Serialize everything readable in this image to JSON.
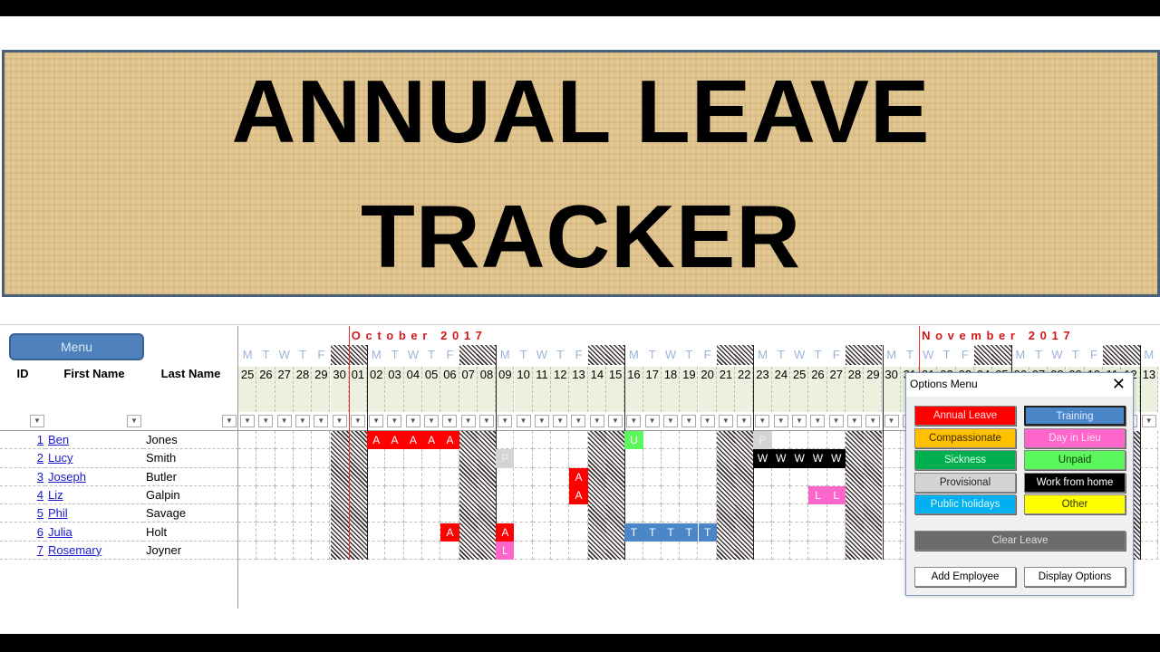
{
  "banner": {
    "line1": "ANNUAL LEAVE",
    "line2": "TRACKER"
  },
  "menu_button": "Menu",
  "columns": {
    "id": "ID",
    "first": "First Name",
    "last": "Last Name"
  },
  "months": [
    {
      "label": "O c t o b e r   2 0 1 7",
      "start": "2017-10-01"
    },
    {
      "label": "N o v e m b e r   2 0 1 7",
      "start": "2017-11-01"
    }
  ],
  "days": [
    {
      "d": "25",
      "w": "M"
    },
    {
      "d": "26",
      "w": "T"
    },
    {
      "d": "27",
      "w": "W"
    },
    {
      "d": "28",
      "w": "T"
    },
    {
      "d": "29",
      "w": "F"
    },
    {
      "d": "30",
      "w": ""
    },
    {
      "d": "01",
      "w": ""
    },
    {
      "d": "02",
      "w": "M"
    },
    {
      "d": "03",
      "w": "T"
    },
    {
      "d": "04",
      "w": "W"
    },
    {
      "d": "05",
      "w": "T"
    },
    {
      "d": "06",
      "w": "F"
    },
    {
      "d": "07",
      "w": ""
    },
    {
      "d": "08",
      "w": ""
    },
    {
      "d": "09",
      "w": "M"
    },
    {
      "d": "10",
      "w": "T"
    },
    {
      "d": "11",
      "w": "W"
    },
    {
      "d": "12",
      "w": "T"
    },
    {
      "d": "13",
      "w": "F"
    },
    {
      "d": "14",
      "w": ""
    },
    {
      "d": "15",
      "w": ""
    },
    {
      "d": "16",
      "w": "M"
    },
    {
      "d": "17",
      "w": "T"
    },
    {
      "d": "18",
      "w": "W"
    },
    {
      "d": "19",
      "w": "T"
    },
    {
      "d": "20",
      "w": "F"
    },
    {
      "d": "21",
      "w": ""
    },
    {
      "d": "22",
      "w": ""
    },
    {
      "d": "23",
      "w": "M"
    },
    {
      "d": "24",
      "w": "T"
    },
    {
      "d": "25",
      "w": "W"
    },
    {
      "d": "26",
      "w": "T"
    },
    {
      "d": "27",
      "w": "F"
    },
    {
      "d": "28",
      "w": ""
    },
    {
      "d": "29",
      "w": ""
    },
    {
      "d": "30",
      "w": "M"
    },
    {
      "d": "31",
      "w": "T"
    },
    {
      "d": "01",
      "w": "W"
    },
    {
      "d": "02",
      "w": "T"
    },
    {
      "d": "03",
      "w": "F"
    },
    {
      "d": "04",
      "w": ""
    },
    {
      "d": "05",
      "w": ""
    },
    {
      "d": "06",
      "w": "M"
    },
    {
      "d": "07",
      "w": "T"
    },
    {
      "d": "08",
      "w": "W"
    },
    {
      "d": "09",
      "w": "T"
    },
    {
      "d": "10",
      "w": "F"
    },
    {
      "d": "11",
      "w": ""
    },
    {
      "d": "12",
      "w": ""
    },
    {
      "d": "13",
      "w": "M"
    }
  ],
  "employees": [
    {
      "id": "1",
      "first": "Ben",
      "last": "Jones",
      "leave": [
        [
          "10-02",
          "A"
        ],
        [
          "10-03",
          "A"
        ],
        [
          "10-04",
          "A"
        ],
        [
          "10-05",
          "A"
        ],
        [
          "10-06",
          "A"
        ],
        [
          "10-16",
          "U"
        ],
        [
          "10-23",
          "P"
        ]
      ]
    },
    {
      "id": "2",
      "first": "Lucy",
      "last": "Smith",
      "leave": [
        [
          "10-09",
          "P"
        ],
        [
          "10-23",
          "W"
        ],
        [
          "10-24",
          "W"
        ],
        [
          "10-25",
          "W"
        ],
        [
          "10-26",
          "W"
        ],
        [
          "10-27",
          "W"
        ]
      ]
    },
    {
      "id": "3",
      "first": "Joseph",
      "last": "Butler",
      "leave": [
        [
          "10-13",
          "A"
        ]
      ]
    },
    {
      "id": "4",
      "first": "Liz",
      "last": "Galpin",
      "leave": [
        [
          "10-13",
          "A"
        ],
        [
          "10-26",
          "L"
        ],
        [
          "10-27",
          "L"
        ]
      ]
    },
    {
      "id": "5",
      "first": "Phil",
      "last": "Savage",
      "leave": []
    },
    {
      "id": "6",
      "first": "Julia",
      "last": "Holt",
      "leave": [
        [
          "10-06",
          "A"
        ],
        [
          "10-09",
          "A"
        ],
        [
          "10-16",
          "T"
        ],
        [
          "10-17",
          "T"
        ],
        [
          "10-18",
          "T"
        ],
        [
          "10-19",
          "T"
        ],
        [
          "10-20",
          "T"
        ]
      ]
    },
    {
      "id": "7",
      "first": "Rosemary",
      "last": "Joyner",
      "leave": [
        [
          "10-09",
          "L"
        ]
      ]
    }
  ],
  "leave_colors": {
    "A": "#ff0000",
    "U": "#5cf75c",
    "P": "#d4d4d4",
    "W": "#000000",
    "L": "#ff66cc",
    "T": "#4a86c8"
  },
  "options_menu": {
    "title": "Options Menu",
    "buttons": [
      {
        "label": "Annual Leave",
        "bg": "#ff0000",
        "fg": "#ffe0e0"
      },
      {
        "label": "Training",
        "bg": "#4a86c8",
        "fg": "#e0ecff"
      },
      {
        "label": "Compassionate",
        "bg": "#ffc000",
        "fg": "#3a2a00"
      },
      {
        "label": "Day in Lieu",
        "bg": "#ff66cc",
        "fg": "#ffe0f4"
      },
      {
        "label": "Sickness",
        "bg": "#00b050",
        "fg": "#e0ffe8"
      },
      {
        "label": "Unpaid",
        "bg": "#5cf75c",
        "fg": "#0a3a0a"
      },
      {
        "label": "Provisional",
        "bg": "#d4d4d4",
        "fg": "#222222"
      },
      {
        "label": "Work from home",
        "bg": "#000000",
        "fg": "#ffffff"
      },
      {
        "label": "Public holidays",
        "bg": "#00b0f0",
        "fg": "#e8f8ff"
      },
      {
        "label": "Other",
        "bg": "#ffff00",
        "fg": "#333300"
      }
    ],
    "clear": "Clear Leave",
    "add": "Add Employee",
    "display": "Display Options"
  }
}
